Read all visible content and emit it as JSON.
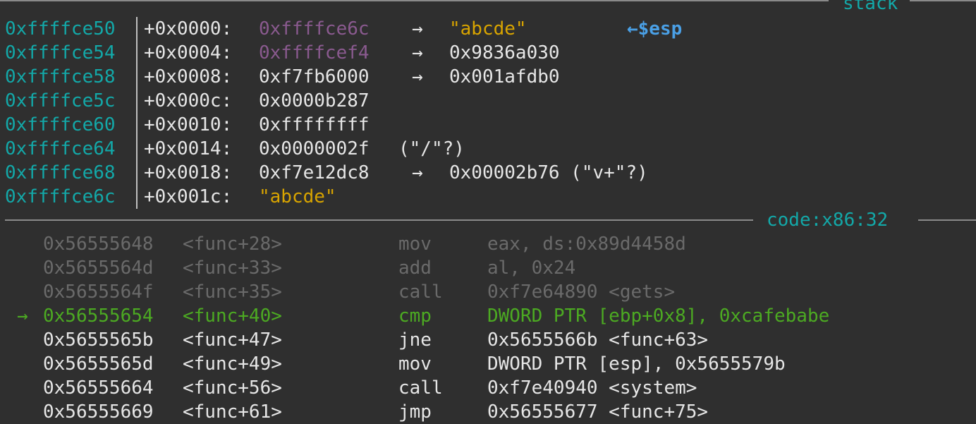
{
  "stack": {
    "title": "stack",
    "rows": [
      {
        "addr": "0xffffce50",
        "off": "+0x0000:",
        "val": "0xffffce6c",
        "arrow": "→",
        "deref": "\"abcde\"",
        "note": "←$esp"
      },
      {
        "addr": "0xffffce54",
        "off": "+0x0004:",
        "val": "0xffffcef4",
        "arrow": "→",
        "deref": "0x9836a030",
        "note": ""
      },
      {
        "addr": "0xffffce58",
        "off": "+0x0008:",
        "val": "0xf7fb6000",
        "arrow": "→",
        "deref": "0x001afdb0",
        "note": ""
      },
      {
        "addr": "0xffffce5c",
        "off": "+0x000c:",
        "val": "0x0000b287",
        "arrow": "",
        "deref": "",
        "note": ""
      },
      {
        "addr": "0xffffce60",
        "off": "+0x0010:",
        "val": "0xffffffff",
        "arrow": "",
        "deref": "",
        "note": ""
      },
      {
        "addr": "0xffffce64",
        "off": "+0x0014:",
        "val": "0x0000002f",
        "arrow": "",
        "deref": "(\"/\"?)",
        "note": ""
      },
      {
        "addr": "0xffffce68",
        "off": "+0x0018:",
        "val": "0xf7e12dc8",
        "arrow": "→",
        "deref": "0x00002b76 (\"v+\"?)",
        "note": ""
      },
      {
        "addr": "0xffffce6c",
        "off": "+0x001c:",
        "val": "\"abcde\"",
        "arrow": "",
        "deref": "",
        "note": ""
      }
    ]
  },
  "code": {
    "title": "code:x86:32",
    "current_marker": "→",
    "rows": [
      {
        "addr": "0x56555648",
        "sym": "<func+28>",
        "mn": "mov",
        "op": "eax, ds:0x89d4458d",
        "state": "past"
      },
      {
        "addr": "0x5655564d",
        "sym": "<func+33>",
        "mn": "add",
        "op": "al, 0x24",
        "state": "past"
      },
      {
        "addr": "0x5655564f",
        "sym": "<func+35>",
        "mn": "call",
        "op": "0xf7e64890 <gets>",
        "state": "past"
      },
      {
        "addr": "0x56555654",
        "sym": "<func+40>",
        "mn": "cmp",
        "op": "DWORD PTR [ebp+0x8], 0xcafebabe",
        "state": "cur"
      },
      {
        "addr": "0x5655565b",
        "sym": "<func+47>",
        "mn": "jne",
        "op": "0x5655566b <func+63>",
        "state": "next"
      },
      {
        "addr": "0x5655565d",
        "sym": "<func+49>",
        "mn": "mov",
        "op": "DWORD PTR [esp], 0x5655579b",
        "state": "next"
      },
      {
        "addr": "0x56555664",
        "sym": "<func+56>",
        "mn": "call",
        "op": "0xf7e40940 <system>",
        "state": "next"
      },
      {
        "addr": "0x56555669",
        "sym": "<func+61>",
        "mn": "jmp",
        "op": "0x56555677 <func+75>",
        "state": "next"
      }
    ]
  }
}
